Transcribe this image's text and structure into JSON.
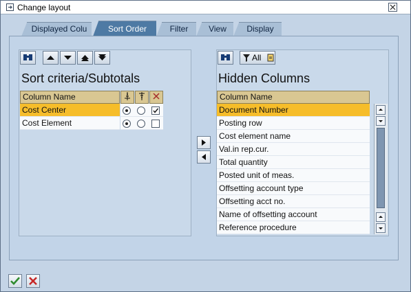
{
  "window": {
    "title": "Change layout",
    "icon": "layout-change-icon",
    "close_icon": "close-icon"
  },
  "tabs": [
    {
      "label": "Displayed Colu",
      "active": false
    },
    {
      "label": "Sort Order",
      "active": true
    },
    {
      "label": "Filter",
      "active": false
    },
    {
      "label": "View",
      "active": false
    },
    {
      "label": "Display",
      "active": false
    }
  ],
  "sort_panel": {
    "title": "Sort criteria/Subtotals",
    "toolbar_icons": [
      "find-icon",
      "move-up-icon",
      "move-down-icon",
      "move-top-icon",
      "move-bottom-icon"
    ],
    "column_header": "Column Name",
    "header_icons": [
      "ascending-sort-icon",
      "descending-sort-icon",
      "subtotal-icon"
    ],
    "rows": [
      {
        "name": "Cost Center",
        "ascending": true,
        "descending": false,
        "subtotal": true,
        "selected": true
      },
      {
        "name": "Cost Element",
        "ascending": true,
        "descending": false,
        "subtotal": false,
        "selected": false
      }
    ]
  },
  "hidden_panel": {
    "title": "Hidden Columns",
    "toolbar_icons": [
      "find-icon",
      "filter-all-icon"
    ],
    "filter_label": "All",
    "column_header": "Column Name",
    "rows": [
      {
        "name": "Document Number",
        "selected": true
      },
      {
        "name": "Posting row",
        "selected": false
      },
      {
        "name": "Cost element name",
        "selected": false
      },
      {
        "name": "Val.in rep.cur.",
        "selected": false
      },
      {
        "name": "Total quantity",
        "selected": false
      },
      {
        "name": "Posted unit of meas.",
        "selected": false
      },
      {
        "name": "Offsetting account type",
        "selected": false
      },
      {
        "name": "Offsetting acct no.",
        "selected": false
      },
      {
        "name": "Name of offsetting account",
        "selected": false
      },
      {
        "name": "Reference procedure",
        "selected": false
      }
    ]
  },
  "transfer_buttons": [
    "move-right-icon",
    "move-left-icon"
  ],
  "footer": {
    "confirm_icon": "checkmark-icon",
    "cancel_icon": "cancel-icon"
  },
  "colors": {
    "accent": "#4e7aa4",
    "selection": "#f6bd2a",
    "header": "#d9c792"
  }
}
